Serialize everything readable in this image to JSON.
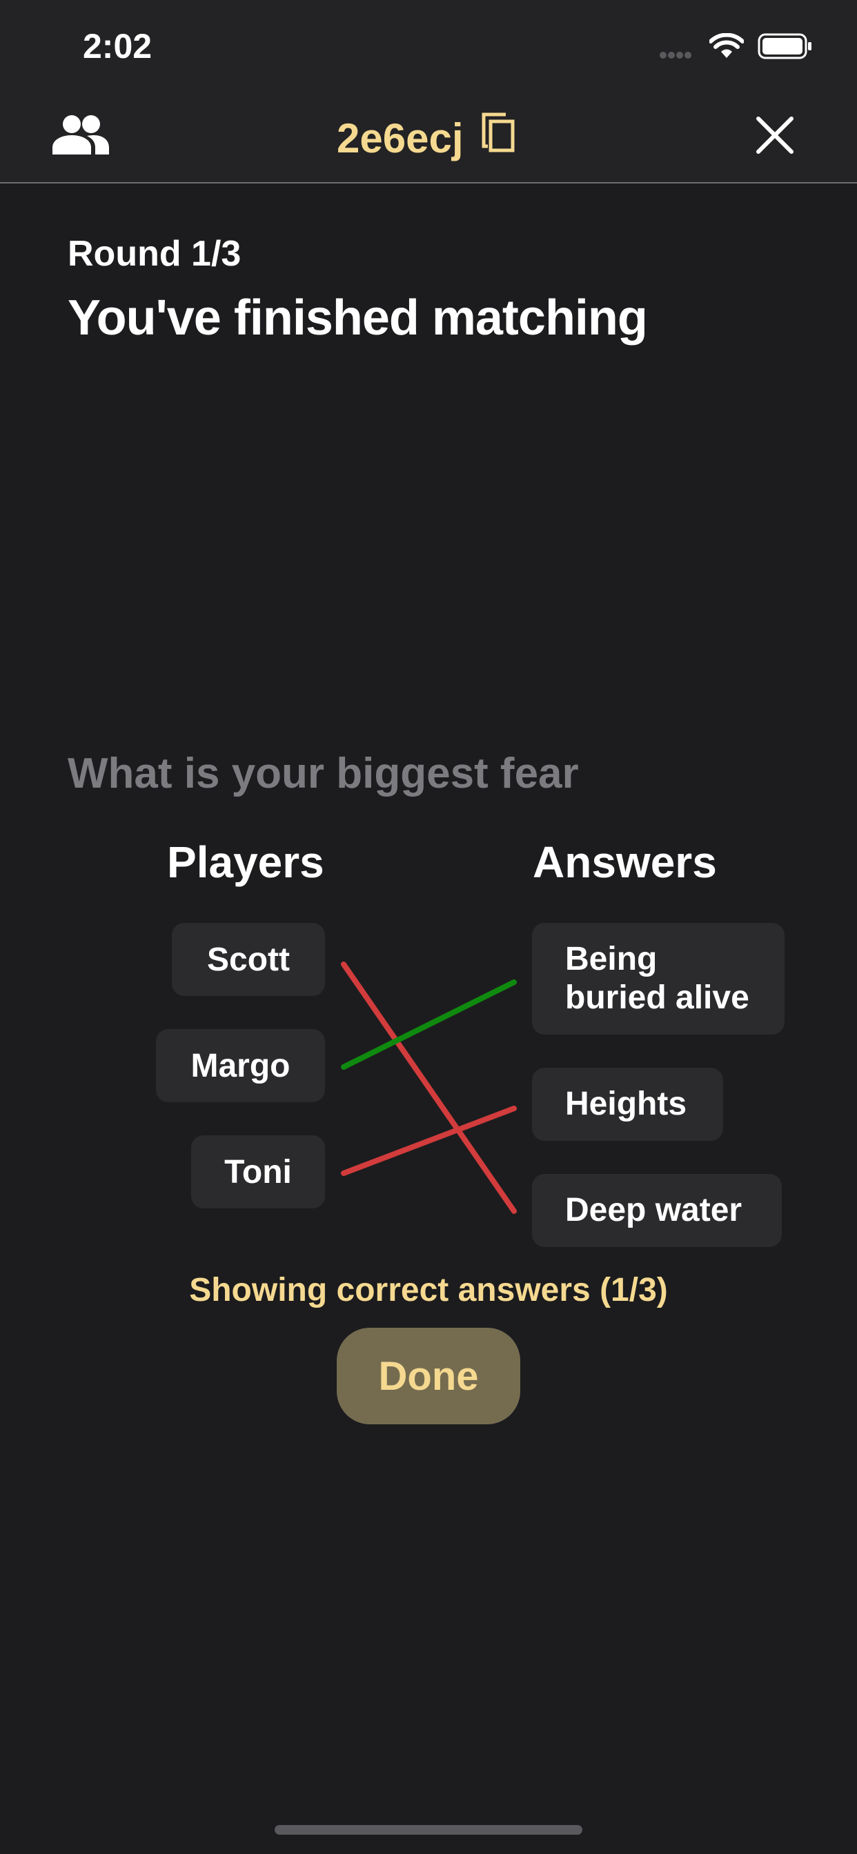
{
  "status_bar": {
    "time": "2:02"
  },
  "header": {
    "room_code": "2e6ecj"
  },
  "round": {
    "label": "Round 1/3",
    "title": "You've finished matching"
  },
  "question": "What is your biggest fear",
  "columns": {
    "players_header": "Players",
    "answers_header": "Answers"
  },
  "players": [
    "Scott",
    "Margo",
    "Toni"
  ],
  "answers": [
    "Being\nburied alive",
    "Heights",
    "Deep water"
  ],
  "matches": [
    {
      "player": "Scott",
      "answer": "Deep water",
      "correct": false
    },
    {
      "player": "Margo",
      "answer": "Being buried alive",
      "correct": true
    },
    {
      "player": "Toni",
      "answer": "Heights",
      "correct": false
    }
  ],
  "hint": "Showing correct answers (1/3)",
  "done_label": "Done",
  "colors": {
    "background": "#1c1c1e",
    "accent": "#f5d990",
    "correct_line": "#0f8a0f",
    "wrong_line": "#d23c3c",
    "button_bg": "#756c50"
  },
  "icons": {
    "players": "people-icon",
    "copy": "copy-icon",
    "close": "close-icon"
  }
}
